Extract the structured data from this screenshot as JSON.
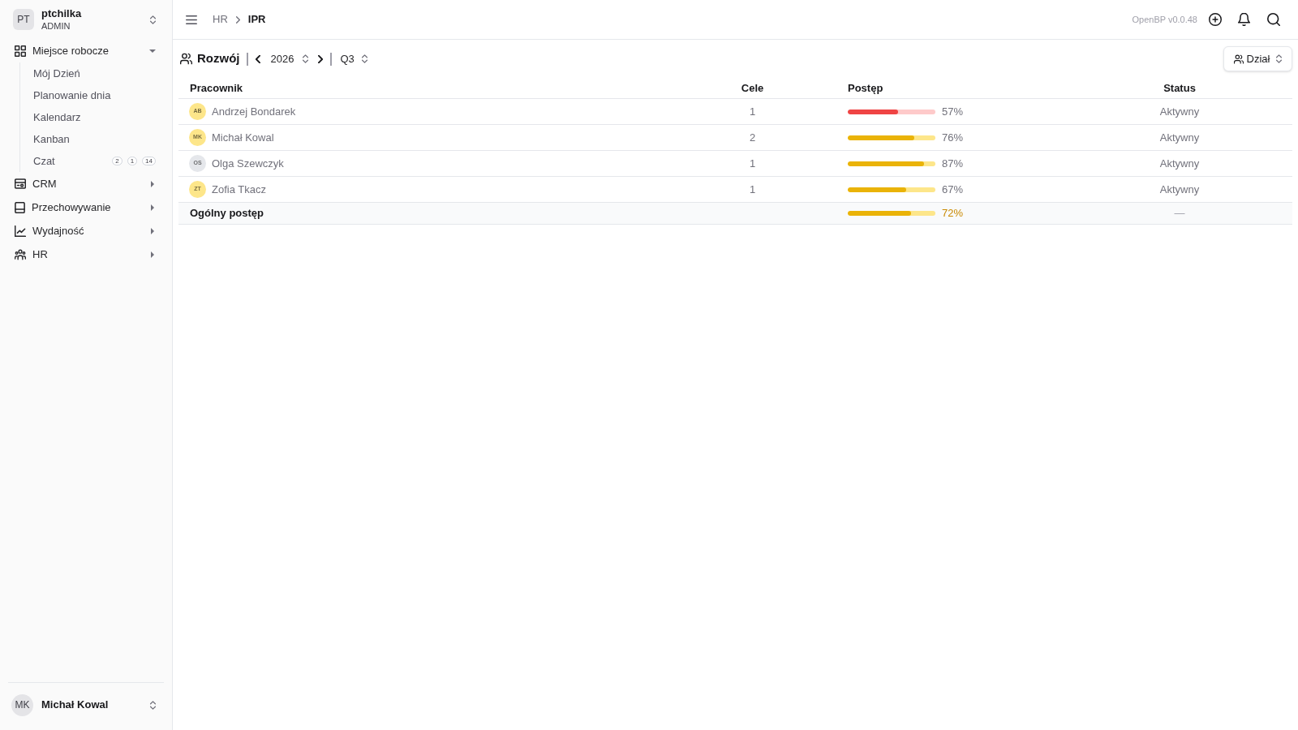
{
  "sidebar": {
    "workspace": {
      "initials": "PT",
      "name": "ptchilka",
      "role": "ADMIN"
    },
    "items": [
      {
        "label": "Miejsce robocze",
        "expanded": true,
        "children": [
          {
            "label": "Mój Dzień"
          },
          {
            "label": "Planowanie dnia"
          },
          {
            "label": "Kalendarz"
          },
          {
            "label": "Kanban"
          },
          {
            "label": "Czat",
            "badges": [
              "2",
              "1",
              "14"
            ]
          }
        ]
      },
      {
        "label": "CRM",
        "expanded": false
      },
      {
        "label": "Przechowywanie",
        "expanded": false
      },
      {
        "label": "Wydajność",
        "expanded": false
      },
      {
        "label": "HR",
        "expanded": false
      }
    ],
    "user": {
      "initials": "MK",
      "name": "Michał Kowal"
    }
  },
  "breadcrumb": [
    "HR",
    "IPR"
  ],
  "version": "OpenBP v0.0.48",
  "toolbar": {
    "title": "Rozwój",
    "year": "2026",
    "quarter": "Q3",
    "filter": "Dział"
  },
  "table": {
    "columns": [
      "Pracownik",
      "Cele",
      "Postęp",
      "Status"
    ],
    "rows": [
      {
        "initials": "AB",
        "name": "Andrzej Bondarek",
        "color": "#fde68a",
        "goals": "1",
        "level": 0.57,
        "percent": "57%",
        "status": "Aktywny"
      },
      {
        "initials": "MK",
        "name": "Michał Kowal",
        "color": "#fde68a",
        "goals": "2",
        "level": 0.76,
        "percent": "76%",
        "status": "Aktywny"
      },
      {
        "initials": "OS",
        "name": "Olga Szewczyk",
        "color": "#e5e7eb",
        "goals": "1",
        "level": 0.87,
        "percent": "87%",
        "status": "Aktywny"
      },
      {
        "initials": "ZT",
        "name": "Zofia Tkacz",
        "color": "#fde68a",
        "goals": "1",
        "level": 0.67,
        "percent": "67%",
        "status": "Aktywny"
      }
    ],
    "summary": {
      "label": "Ogólny postęp",
      "level": 0.72,
      "percent": "72%",
      "status": "—"
    }
  }
}
